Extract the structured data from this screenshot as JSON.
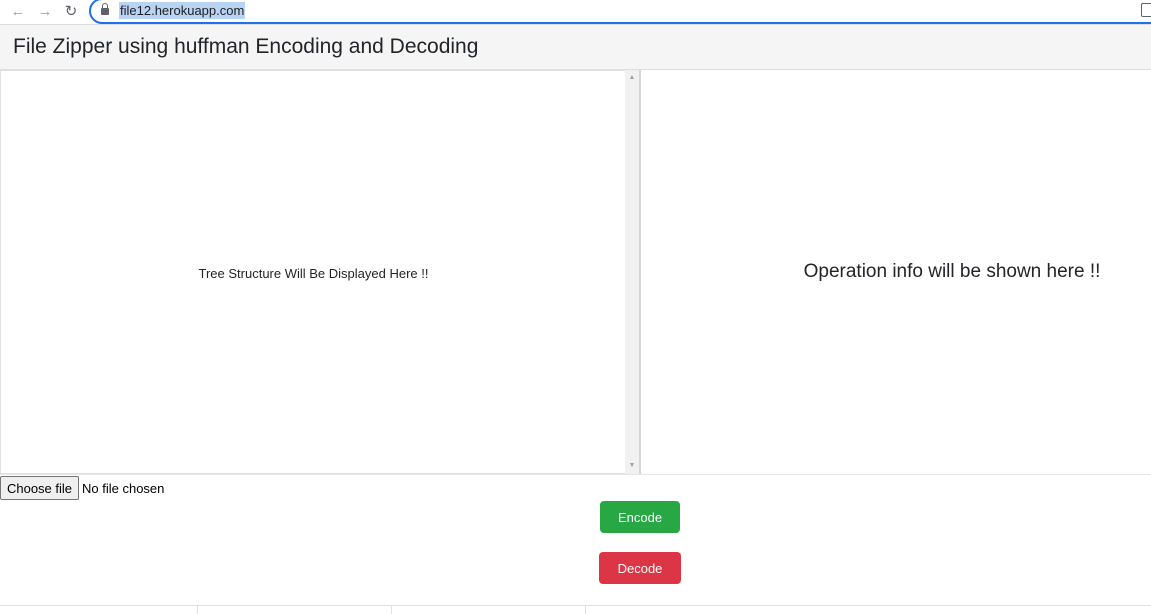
{
  "browser": {
    "url": "file12.herokuapp.com"
  },
  "header": {
    "title": "File Zipper using huffman Encoding and Decoding"
  },
  "tree_panel": {
    "placeholder": "Tree Structure Will Be Displayed Here !!"
  },
  "info_panel": {
    "placeholder": "Operation info will be shown here !!"
  },
  "file_input": {
    "button_label": "Choose file",
    "status": "No file chosen"
  },
  "actions": {
    "encode_label": "Encode",
    "decode_label": "Decode",
    "encode_color": "#28a745",
    "decode_color": "#dc3545"
  }
}
